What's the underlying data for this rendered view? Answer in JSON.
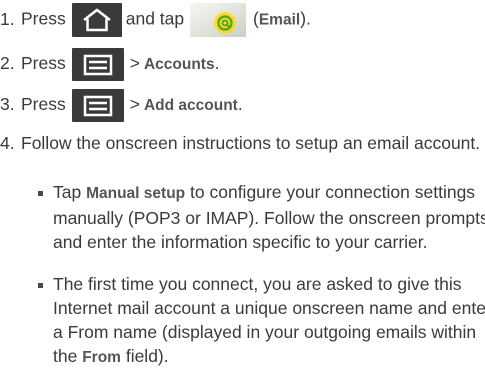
{
  "steps": [
    {
      "number": "1.",
      "pre": "Press",
      "mid": "and tap",
      "bold": "Email",
      "post": ")."
    },
    {
      "number": "2.",
      "pre": "Press",
      "sep": ">",
      "bold": "Accounts",
      "post": "."
    },
    {
      "number": "3.",
      "pre": "Press",
      "sep": ">",
      "bold": "Add account",
      "post": "."
    },
    {
      "number": "4.",
      "text": "Follow the onscreen instructions to setup an email account."
    }
  ],
  "bullets": [
    {
      "pre": "Tap",
      "bold": "Manual setup",
      "post": "to configure your connection settings manually (POP3 or IMAP). Follow the onscreen prompts and enter the information specific to your carrier."
    },
    {
      "pre": "The first time you connect, you are asked to give this Internet mail account a unique onscreen name and enter a From name (displayed in your outgoing emails within the",
      "bold": "From",
      "post": "field)."
    }
  ],
  "icons": {
    "home": "home-icon",
    "menu": "menu-icon",
    "email": "email-app-icon"
  },
  "colors": {
    "icon_bg": "#3a3a3a",
    "email_at": "#5aa81c"
  }
}
